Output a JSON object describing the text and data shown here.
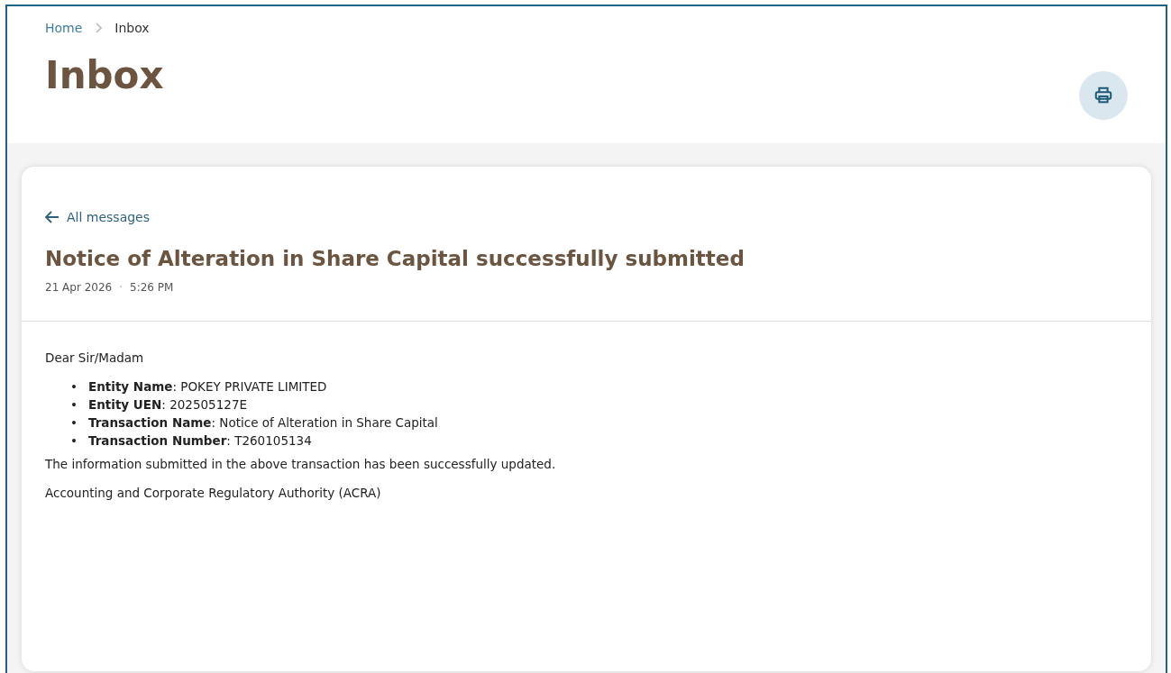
{
  "breadcrumb": [
    {
      "label": "Home"
    },
    {
      "label": "Inbox"
    }
  ],
  "page_title": "Inbox",
  "message": {
    "back_link": "All messages",
    "subject": "Notice of Alteration in Share Capital successfully submitted",
    "date": "21 Apr 2026",
    "separator": "·",
    "time": "5:26 PM",
    "greeting": "Dear Sir/Madam",
    "details": [
      {
        "marker": "•",
        "text": "**Entity Name**: POKEY PRIVATE LIMITED"
      },
      {
        "marker": "•",
        "text": "**Entity UEN**: 202505127E"
      },
      {
        "marker": "•",
        "text": "**Transaction Name**: Notice of Alteration in Share Capital"
      },
      {
        "marker": "•",
        "text": "**Transaction Number**: T260105134"
      }
    ],
    "body": "The information submitted in the above transaction has been successfully updated.",
    "signature": "Accounting and Corporate Regulatory Authority (ACRA)"
  }
}
